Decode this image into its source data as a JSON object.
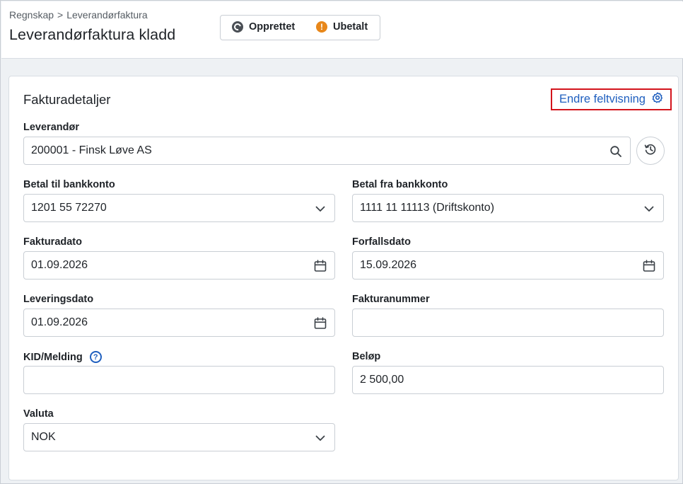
{
  "breadcrumb": {
    "root": "Regnskap",
    "separator": ">",
    "current": "Leverandørfaktura"
  },
  "page_title": "Leverandørfaktura kladd",
  "statuses": [
    {
      "label": "Opprettet",
      "icon": "sync-icon",
      "color": "#4a4f55"
    },
    {
      "label": "Ubetalt",
      "icon": "warning-icon",
      "color": "#e8871a"
    }
  ],
  "card": {
    "title": "Fakturadetaljer",
    "edit_view_label": "Endre feltvisning",
    "edit_view_icon": "gear-icon"
  },
  "fields": {
    "supplier": {
      "label": "Leverandør",
      "value": "200001 - Finsk Løve AS",
      "icon": "search-icon",
      "history_icon": "history-icon"
    },
    "pay_to_account": {
      "label": "Betal til bankkonto",
      "value": "1201 55 72270",
      "icon": "chevron-down-icon"
    },
    "pay_from_account": {
      "label": "Betal fra bankkonto",
      "value": "1111 11 11113 (Driftskonto)",
      "icon": "chevron-down-icon"
    },
    "invoice_date": {
      "label": "Fakturadato",
      "value": "01.09.2026",
      "icon": "calendar-icon"
    },
    "due_date": {
      "label": "Forfallsdato",
      "value": "15.09.2026",
      "icon": "calendar-icon"
    },
    "delivery_date": {
      "label": "Leveringsdato",
      "value": "01.09.2026",
      "icon": "calendar-icon"
    },
    "invoice_number": {
      "label": "Fakturanummer",
      "value": ""
    },
    "kid_message": {
      "label": "KID/Melding",
      "value": "",
      "help_icon": "help-icon"
    },
    "amount": {
      "label": "Beløp",
      "value": "2 500,00"
    },
    "currency": {
      "label": "Valuta",
      "value": "NOK",
      "icon": "chevron-down-icon"
    }
  },
  "colors": {
    "accent": "#1f5fbf",
    "highlight_border": "#d3141c",
    "warning": "#e8871a"
  }
}
